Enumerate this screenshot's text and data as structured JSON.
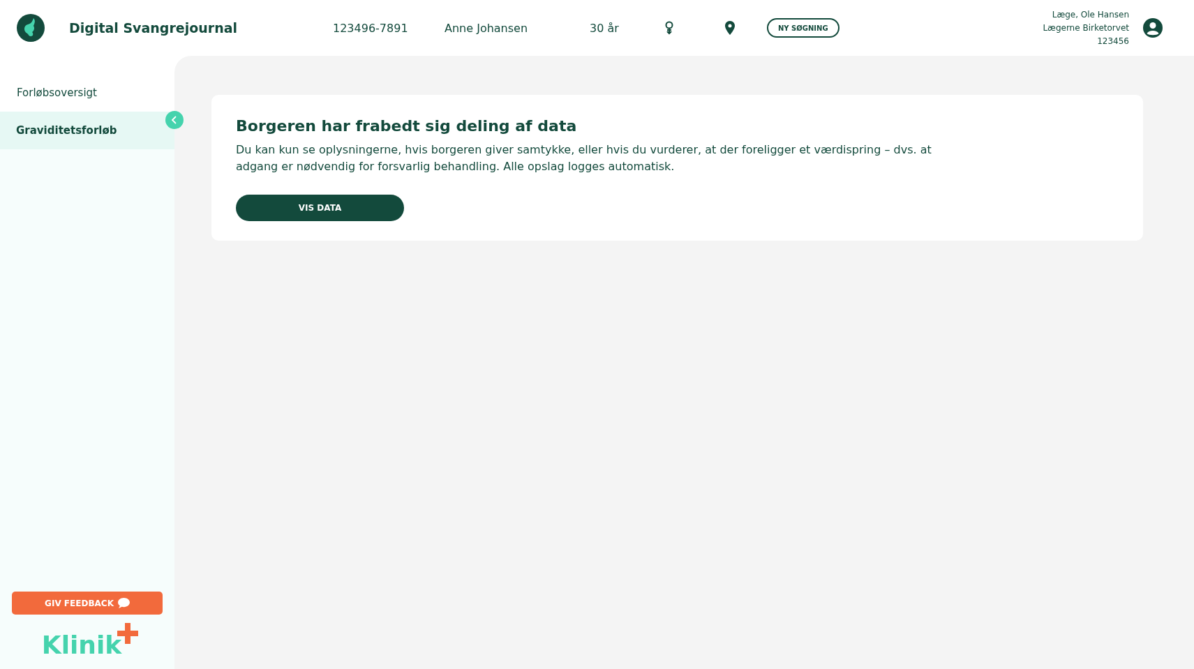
{
  "header": {
    "app_title": "Digital Svangrejournal",
    "cpr": "123496-7891",
    "patient_name": "Anne Johansen",
    "age": "30 år",
    "new_search_button": "NY SØGNING",
    "user": {
      "role_name": "Læge, Ole Hansen",
      "clinic": "Lægerne Birketorvet",
      "number": "123456"
    }
  },
  "sidebar": {
    "items": [
      {
        "label": "Forløbsoversigt",
        "selected": false
      },
      {
        "label": "Graviditetsforløb",
        "selected": true
      }
    ],
    "feedback_button": "GIV FEEDBACK",
    "brand": "Klinik"
  },
  "notice": {
    "title": "Borgeren har frabedt sig deling af data",
    "body": "Du kan kun se oplysningerne, hvis borgeren giver samtykke, eller hvis du vurderer, at der foreligger et værdispring – dvs. at adgang er nødvendig for forsvarlig behandling. Alle opslag logges automatisk.",
    "button": "VIS DATA"
  }
}
